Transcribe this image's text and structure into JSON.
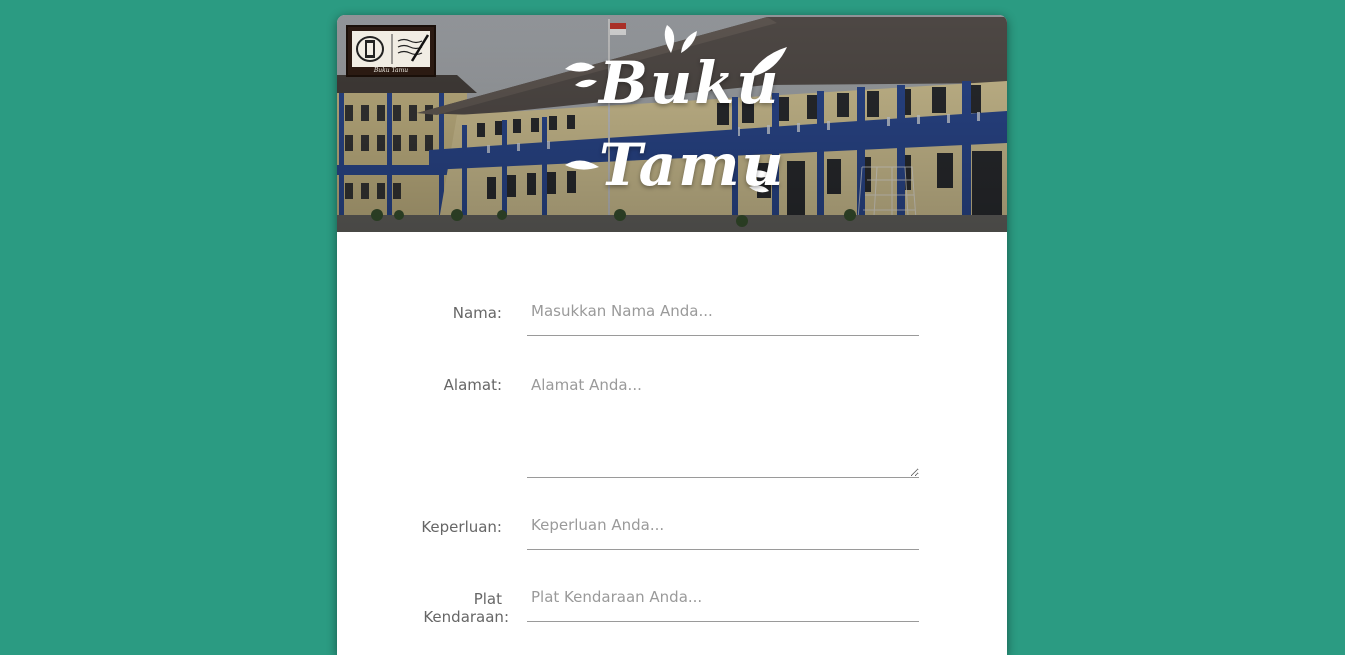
{
  "header": {
    "logo_alt": "school-crest",
    "logo_caption": "Buku Tamu",
    "title_line1": "Buku",
    "title_line2": "Tamu"
  },
  "form": {
    "fields": [
      {
        "label": "Nama:",
        "placeholder": "Masukkan Nama Anda...",
        "value": ""
      },
      {
        "label": "Alamat:",
        "placeholder": "Alamat Anda...",
        "value": ""
      },
      {
        "label": "Keperluan:",
        "placeholder": "Keperluan Anda...",
        "value": ""
      },
      {
        "label_line1": "Plat",
        "label_line2": "Kendaraan:",
        "placeholder": "Plat Kendaraan Anda...",
        "value": ""
      }
    ]
  },
  "colors": {
    "page_background": "#2b9b82",
    "card_background": "#ffffff",
    "label_text": "#666666",
    "placeholder_text": "#9a9a9a",
    "building_wall": "#e6d6a2",
    "building_trim": "#2f4f9c",
    "roof": "#5b5450"
  }
}
